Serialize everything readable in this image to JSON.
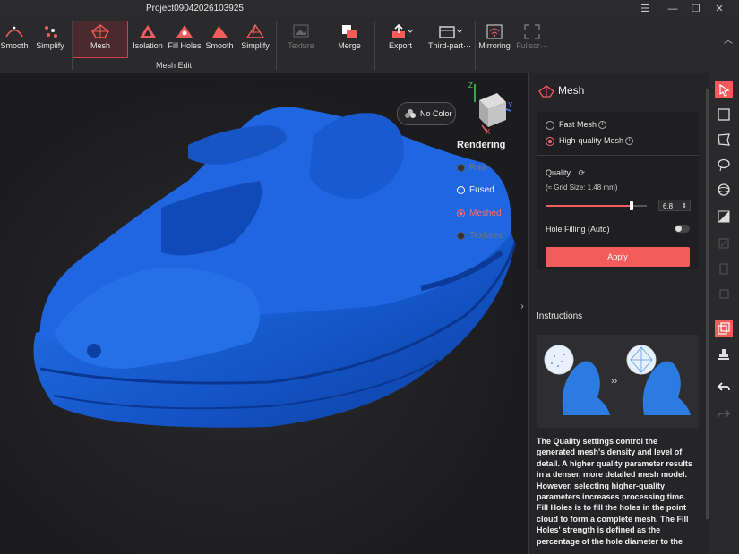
{
  "window": {
    "title": "Project09042026103925"
  },
  "toolbar": {
    "left_items": [
      "Smooth",
      "Simplify"
    ],
    "mesh_edit": [
      "Mesh",
      "Isolation",
      "Fill Holes",
      "Smooth",
      "Simplify"
    ],
    "mesh_edit_group": "Mesh Edit",
    "texture": "Texture",
    "merge": "Merge",
    "export": "Export",
    "third_party": "Third-part···",
    "mirroring": "Mirroring",
    "fullscreen": "Fullscr···"
  },
  "viewport": {
    "no_color": "No Color",
    "rendering_title": "Rendering",
    "rendering_options": [
      {
        "label": "Raw",
        "state": "disabled"
      },
      {
        "label": "Fused",
        "state": "normal"
      },
      {
        "label": "Meshed",
        "state": "selected"
      },
      {
        "label": "Textured",
        "state": "disabled"
      }
    ],
    "axis_labels": {
      "y": "Y",
      "x": "X",
      "z": "Z"
    }
  },
  "panel": {
    "title": "Mesh",
    "fast_mesh": "Fast Mesh",
    "high_quality_mesh": "High-quality Mesh",
    "selected_mode": "High-quality Mesh",
    "quality_label": "Quality",
    "grid_size": "(≈ Grid Size: 1.48 mm)",
    "quality_value": "6.8",
    "quality_fraction": 0.85,
    "hole_filling": "Hole Filling (Auto)",
    "hole_filling_on": false,
    "apply": "Apply",
    "instructions_title": "Instructions",
    "description": "The Quality settings control the generated mesh's density and level of detail. A higher quality parameter results in a denser, more detailed mesh model. However, selecting higher-quality parameters increases processing time. Fill Holes is to fill the holes in the point cloud to form a complete mesh. The Fill Holes' strength is defined as the percentage of the hole diameter to the"
  },
  "colors": {
    "accent": "#f45b5b",
    "model": "#1a5fd6",
    "panel": "#252528"
  }
}
